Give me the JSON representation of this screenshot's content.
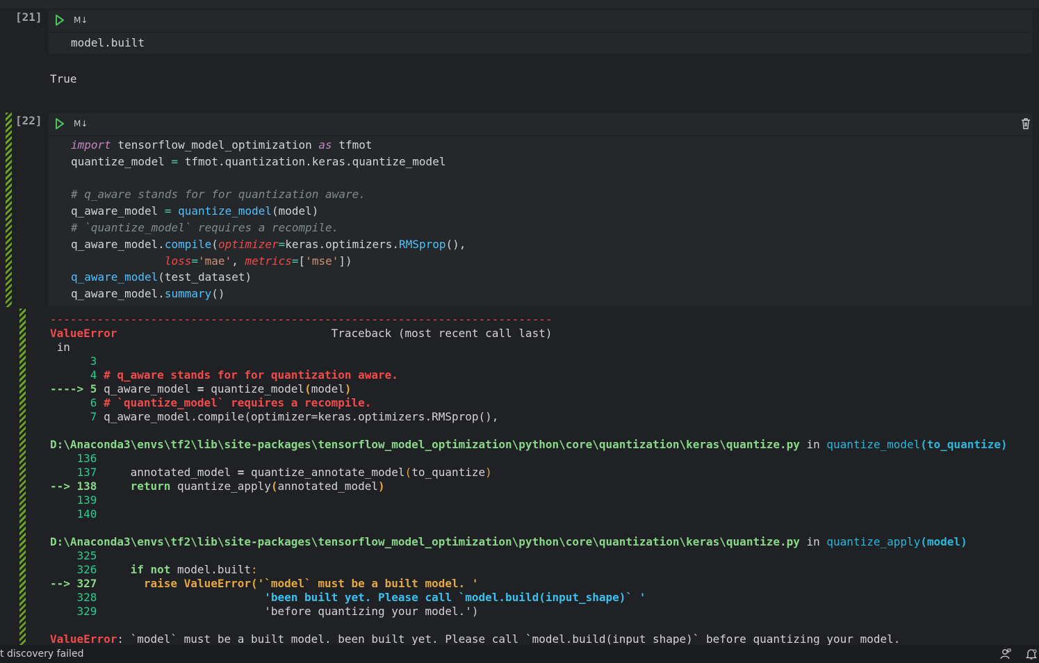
{
  "cell21": {
    "prompt": "[21]",
    "md_label": "M↓",
    "code": "model.built",
    "output": "True"
  },
  "cell22": {
    "prompt": "[22]",
    "md_label": "M↓",
    "code": {
      "l1_kw1": "import",
      "l1_mod": " tensorflow_model_optimization ",
      "l1_kw2": "as",
      "l1_alias": " tfmot",
      "l2_a": "quantize_model ",
      "l2_eq": "=",
      "l2_b": " tfmot.quantization.keras.quantize_model",
      "l4": "# q_aware stands for for quantization aware.",
      "l5_a": "q_aware_model ",
      "l5_eq": "=",
      "l5_sp": " ",
      "l5_fn": "quantize_model",
      "l5_b": "(model)",
      "l6": "# `quantize_model` requires a recompile.",
      "l7_a": "q_aware_model.",
      "l7_fn": "compile",
      "l7_p1": "(",
      "l7_param": "optimizer",
      "l7_eq": "=",
      "l7_b": "keras.optimizers.",
      "l7_fn2": "RMSprop",
      "l7_c": "(),",
      "l8_ind": "              ",
      "l8_param": "loss",
      "l8_eq": "=",
      "l8_str": "'mae'",
      "l8_comma": ", ",
      "l8_param2": "metrics",
      "l8_eq2": "=",
      "l8_br1": "[",
      "l8_str2": "'mse'",
      "l8_br2": "])",
      "l9_fn": "q_aware_model",
      "l9_b": "(test_dataset)",
      "l10_a": "q_aware_model.",
      "l10_fn": "summary",
      "l10_b": "()"
    }
  },
  "traceback": {
    "dashes": "---------------------------------------------------------------------------",
    "error_name": "ValueError",
    "header_tail": "                                Traceback (most recent call last)",
    "in_line": " in",
    "block1": {
      "l3": "      3",
      "l4_num": "      4 ",
      "l4_text": "# q_aware stands for for quantization aware.",
      "l5_arrow": "----> 5 ",
      "l5_a": "q_aware_model ",
      "l5_eq": "=",
      "l5_b": " quantize_model",
      "l5_p1": "(",
      "l5_c": "model",
      "l5_p2": ")",
      "l6_num": "      6 ",
      "l6_text": "# `quantize_model` requires a recompile.",
      "l7_num": "      7 ",
      "l7_text": "q_aware_model.compile(optimizer=keras.optimizers.RMSprop(),"
    },
    "block2": {
      "path": "D:\\Anaconda3\\envs\\tf2\\lib\\site-packages\\tensorflow_model_optimization\\python\\core\\quantization\\keras\\quantize.py",
      "in": " in ",
      "func": "quantize_model",
      "args": "(to_quantize)",
      "l136": "    136",
      "l137_num": "    137 ",
      "l137_a": "    annotated_model ",
      "l137_eq": "=",
      "l137_b": " quantize_annotate_model",
      "l137_p1": "(",
      "l137_c": "to_quantize",
      "l137_p2": ")",
      "l138_arrow": "--> 138 ",
      "l138_kw": "    return",
      "l138_b": " quantize_apply",
      "l138_p1": "(",
      "l138_c": "annotated_model",
      "l138_p2": ")",
      "l139": "    139",
      "l140": "    140"
    },
    "block3": {
      "path": "D:\\Anaconda3\\envs\\tf2\\lib\\site-packages\\tensorflow_model_optimization\\python\\core\\quantization\\keras\\quantize.py",
      "in": " in ",
      "func": "quantize_apply",
      "args": "(model)",
      "l325": "    325",
      "l326_num": "    326 ",
      "l326_kw": "    if not",
      "l326_b": " model.built",
      "l326_colon": ":",
      "l327_arrow": "--> 327 ",
      "l327_kw": "      raise",
      "l327_b": " ValueError(",
      "l327_str": "'`model` must be a built model. '",
      "l328_num": "    328 ",
      "l328_str": "                        'been built yet. Please call `model.build(input_shape)` '",
      "l329_num": "    329 ",
      "l329_str": "                        'before quantizing your model.'",
      "l329_close": ")"
    },
    "final_name": "ValueError",
    "final_msg": ": `model` must be a built model. been built yet. Please call `model.build(input shape)` before quantizing your model."
  },
  "status": {
    "text": "t discovery failed"
  },
  "colors": {
    "background": "#1f2124",
    "cell_background": "#25282b",
    "error_red": "#f14c4c",
    "path_green": "#8ad88a",
    "link_teal": "#29b8db",
    "stripe_green": "#6d9f2a"
  }
}
